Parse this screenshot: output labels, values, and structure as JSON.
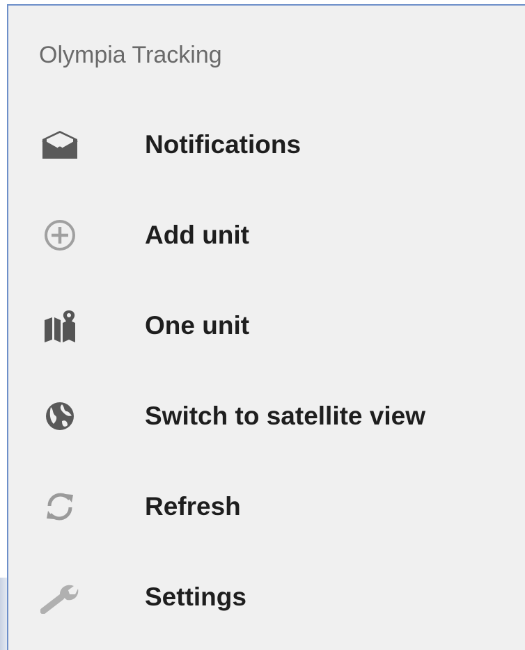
{
  "app": {
    "title": "Olympia Tracking"
  },
  "menu": {
    "items": [
      {
        "id": "notifications",
        "label": "Notifications",
        "icon": "mail-open-icon"
      },
      {
        "id": "add-unit",
        "label": "Add unit",
        "icon": "add-circle-icon"
      },
      {
        "id": "one-unit",
        "label": "One unit",
        "icon": "map-pin-icon"
      },
      {
        "id": "satellite",
        "label": "Switch to satellite view",
        "icon": "globe-icon"
      },
      {
        "id": "refresh",
        "label": "Refresh",
        "icon": "refresh-icon"
      },
      {
        "id": "settings",
        "label": "Settings",
        "icon": "wrench-icon"
      }
    ]
  },
  "colors": {
    "drawer_background": "#f0f0f0",
    "label_text": "#1e1e1e",
    "title_text": "#6a6a6a",
    "icon_dark": "#555555",
    "icon_light": "#9a9a9a",
    "border_accent": "#6d8fc9"
  }
}
